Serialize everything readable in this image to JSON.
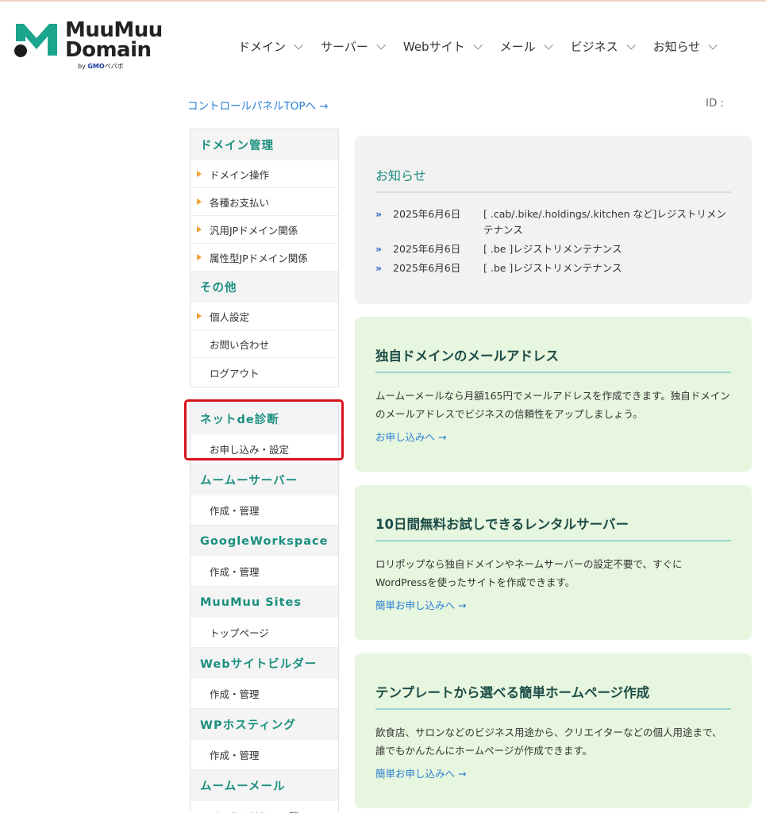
{
  "header": {
    "logo_line1": "MuuMuu",
    "logo_line2": "Domain",
    "logo_by": "by",
    "logo_gmo": "GMO",
    "logo_pepabo": "ペパボ",
    "nav": [
      "ドメイン",
      "サーバー",
      "Webサイト",
      "メール",
      "ビジネス",
      "お知らせ"
    ]
  },
  "toolbar": {
    "control_panel_link": "コントロールパネルTOPへ →",
    "id_label": "ID :"
  },
  "sidebar": {
    "domain_head": "ドメイン管理",
    "domain_items": [
      "ドメイン操作",
      "各種お支払い",
      "汎用JPドメイン関係",
      "属性型JPドメイン関係"
    ],
    "other_head": "その他",
    "other_items": [
      "個人設定",
      "お問い合わせ",
      "ログアウト"
    ],
    "sections": [
      {
        "head": "ネットde診断",
        "item": "お申し込み・設定"
      },
      {
        "head": "ムームーサーバー",
        "item": "作成・管理"
      },
      {
        "head": "GoogleWorkspace",
        "item": "作成・管理"
      },
      {
        "head": "MuuMuu Sites",
        "item": "トップページ"
      },
      {
        "head": "Webサイトビルダー",
        "item": "作成・管理"
      },
      {
        "head": "WPホスティング",
        "item": "作成・管理"
      },
      {
        "head": "ムームーメール",
        "item": "メールアドレス一覧"
      }
    ]
  },
  "news": {
    "title": "お知らせ",
    "items": [
      {
        "date": "2025年6月6日",
        "text": "[ .cab/.bike/.holdings/.kitchen など]レジストリメンテナンス"
      },
      {
        "date": "2025年6月6日",
        "text": "[ .be ]レジストリメンテナンス"
      },
      {
        "date": "2025年6月6日",
        "text": "[ .be ]レジストリメンテナンス"
      }
    ]
  },
  "promos": [
    {
      "title": "独自ドメインのメールアドレス",
      "body": "ムームーメールなら月額165円でメールアドレスを作成できます。独自ドメインのメールアドレスでビジネスの信頼性をアップしましょう。",
      "link": "お申し込みへ →"
    },
    {
      "title": "10日間無料お試しできるレンタルサーバー",
      "body": "ロリポップなら独自ドメインやネームサーバーの設定不要で、すぐにWordPressを使ったサイトを作成できます。",
      "link": "簡単お申し込みへ →"
    },
    {
      "title": "テンプレートから選べる簡単ホームページ作成",
      "body": "飲食店、サロンなどのビジネス用途から、クリエイターなどの個人用途まで、 誰でもかんたんにホームページが作成できます。",
      "link": "簡単お申し込みへ →"
    }
  ],
  "colors": {
    "accent_green": "#1b8f7f",
    "link_blue": "#2a7fd4",
    "highlight_red": "#d8111c",
    "promo_bg": "#e7f6de"
  }
}
